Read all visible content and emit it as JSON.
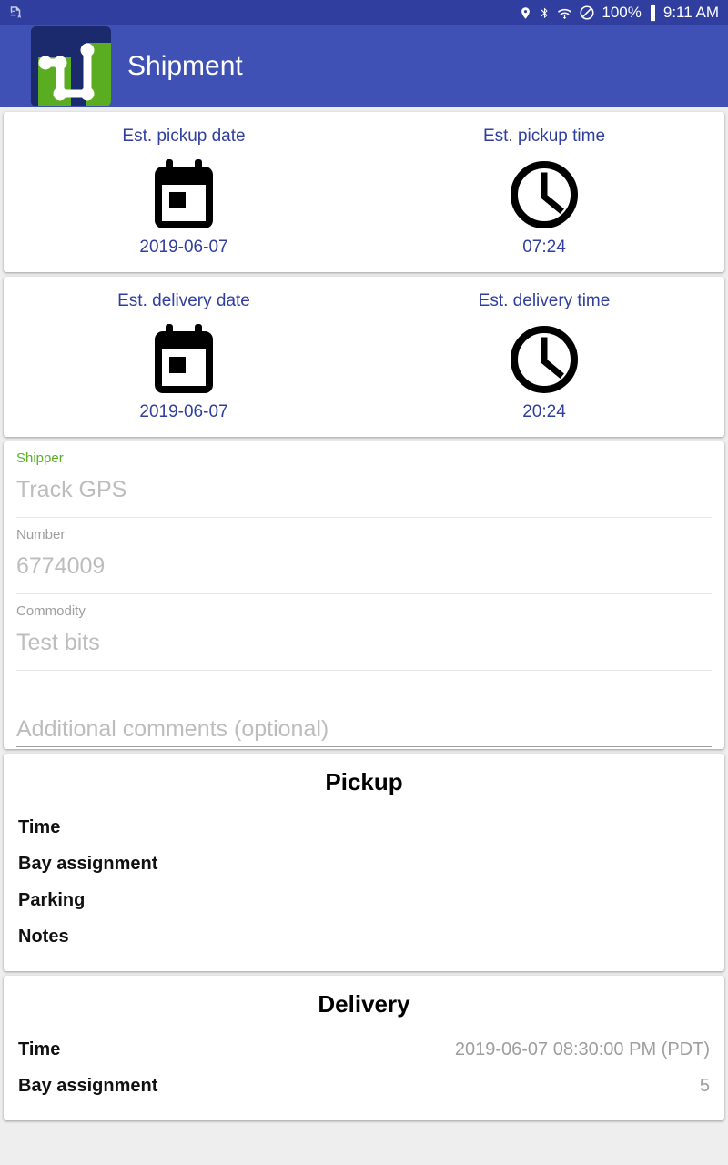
{
  "status_bar": {
    "sim_icon": "sim-card-off-icon",
    "icons": [
      "location-pin-icon",
      "bluetooth-icon",
      "wifi-download-icon",
      "do-not-disturb-icon"
    ],
    "battery_percent": "100%",
    "battery_icon": "battery-full-icon",
    "clock": "9:11 AM",
    "background_color": "#303f9f"
  },
  "app_bar": {
    "title": "Shipment",
    "logo_icon": "route-waypoints-logo",
    "background_color": "#3f51b5",
    "logo_colors": {
      "navy": "#1a2a6c",
      "green": "#5aad21",
      "path": "#ffffff"
    }
  },
  "pickup_estimate_card": {
    "date": {
      "label": "Est. pickup date",
      "icon": "calendar-icon",
      "value": "2019-06-07"
    },
    "time": {
      "label": "Est. pickup time",
      "icon": "clock-icon",
      "value": "07:24"
    },
    "accent_color": "#303f9f"
  },
  "delivery_estimate_card": {
    "date": {
      "label": "Est. delivery date",
      "icon": "calendar-icon",
      "value": "2019-06-07"
    },
    "time": {
      "label": "Est. delivery time",
      "icon": "clock-icon",
      "value": "20:24"
    },
    "accent_color": "#303f9f"
  },
  "details_form": {
    "accent_color": "#58b024",
    "fields": [
      {
        "label": "Shipper",
        "value": "Track GPS",
        "label_accent": true
      },
      {
        "label": "Number",
        "value": "6774009",
        "label_accent": false
      },
      {
        "label": "Commodity",
        "value": "Test bits",
        "label_accent": false
      }
    ],
    "comments": {
      "placeholder": "Additional comments (optional)",
      "value": ""
    }
  },
  "pickup_section": {
    "title": "Pickup",
    "rows": [
      {
        "key": "Time",
        "value": ""
      },
      {
        "key": "Bay assignment",
        "value": ""
      },
      {
        "key": "Parking",
        "value": ""
      },
      {
        "key": "Notes",
        "value": ""
      }
    ]
  },
  "delivery_section": {
    "title": "Delivery",
    "rows": [
      {
        "key": "Time",
        "value": "2019-06-07 08:30:00 PM (PDT)"
      },
      {
        "key": "Bay assignment",
        "value": "5"
      }
    ]
  }
}
